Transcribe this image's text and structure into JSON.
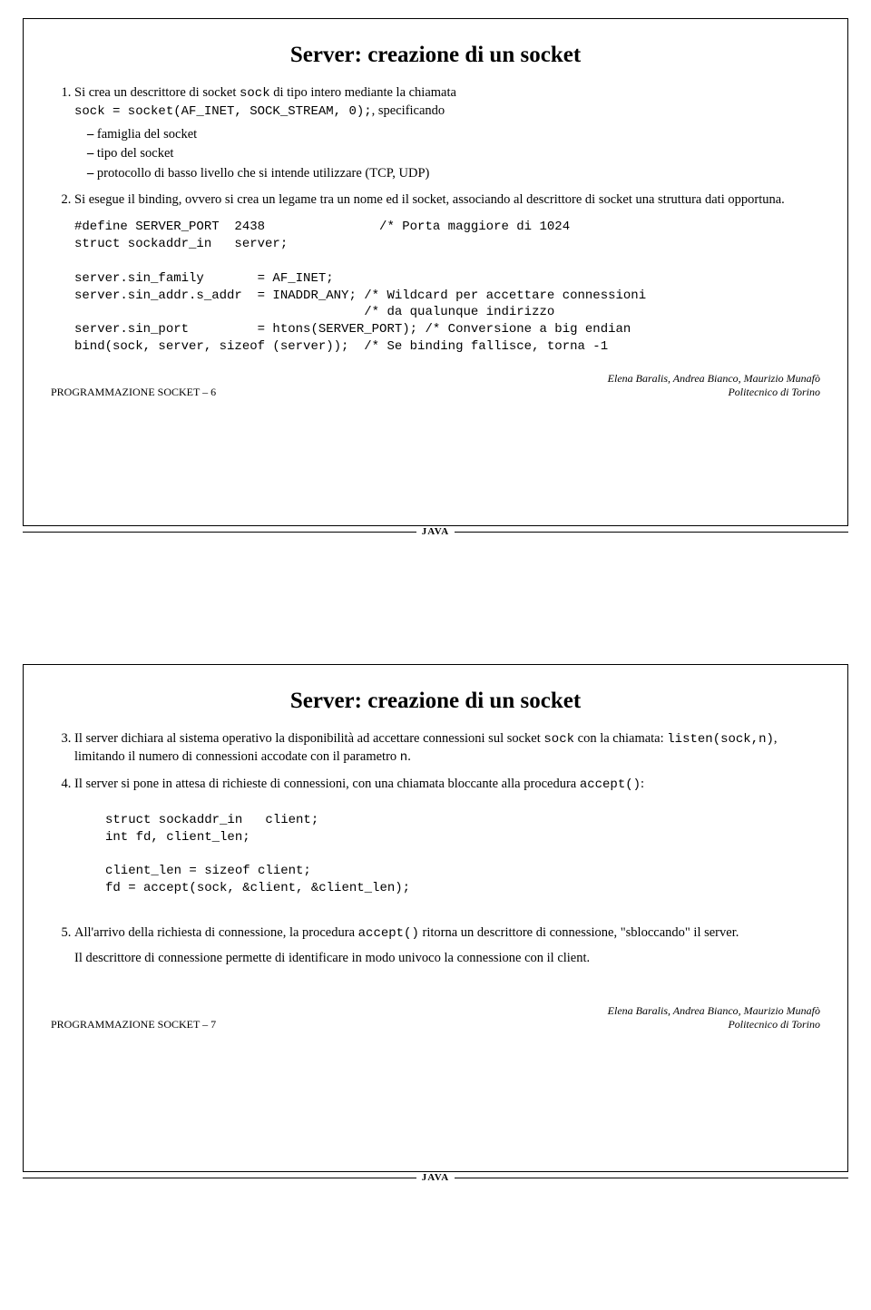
{
  "slide1": {
    "title": "Server: creazione di un socket",
    "item1_a": "Si crea un descrittore di socket ",
    "item1_code1": "sock",
    "item1_b": " di tipo intero mediante la chiamata",
    "item1_codeLine": "sock = socket(AF_INET, SOCK_STREAM, 0);",
    "item1_c": ", specificando",
    "sub1": "famiglia del socket",
    "sub2": "tipo del socket",
    "sub3": "protocollo di basso livello che si intende utilizzare (TCP, UDP)",
    "item2": "Si esegue il binding, ovvero si crea un legame tra un nome ed il socket, associando al descrittore di socket una struttura dati opportuna.",
    "code": "#define SERVER_PORT  2438               /* Porta maggiore di 1024\nstruct sockaddr_in   server;\n\nserver.sin_family       = AF_INET;\nserver.sin_addr.s_addr  = INADDR_ANY; /* Wildcard per accettare connessioni\n                                      /* da qualunque indirizzo\nserver.sin_port         = htons(SERVER_PORT); /* Conversione a big endian\nbind(sock, server, sizeof (server));  /* Se binding fallisce, torna -1",
    "footer_left": "PROGRAMMAZIONE SOCKET – 6",
    "footer_right_line1": "Elena Baralis, Andrea Bianco, Maurizio Munafò",
    "footer_right_line2": "Politecnico di Torino",
    "tag": "JAVA"
  },
  "slide2": {
    "title": "Server: creazione di un socket",
    "item3_a": "Il server dichiara al sistema operativo la disponibilità ad accettare connessioni sul socket ",
    "item3_code1": "sock",
    "item3_b": " con la chiamata: ",
    "item3_code2": "listen(sock,n)",
    "item3_c": ", limitando il numero di connessioni accodate con il parametro ",
    "item3_code3": "n",
    "item3_d": ".",
    "item4_a": "Il server si pone in attesa di richieste di connessioni, con una chiamata bloccante alla procedura ",
    "item4_code1": "accept()",
    "item4_b": ":",
    "code": "struct sockaddr_in   client;\nint fd, client_len;\n\nclient_len = sizeof client;\nfd = accept(sock, &client, &client_len);",
    "item5_a": "All'arrivo della richiesta di connessione, la procedura ",
    "item5_code1": "accept()",
    "item5_b": " ritorna un descrittore di connessione, \"sbloccando\" il server.",
    "item5_para2": "Il descrittore di connessione permette di identificare in modo univoco la connessione con il client.",
    "footer_left": "PROGRAMMAZIONE SOCKET – 7",
    "footer_right_line1": "Elena Baralis, Andrea Bianco, Maurizio Munafò",
    "footer_right_line2": "Politecnico di Torino",
    "tag": "JAVA"
  }
}
